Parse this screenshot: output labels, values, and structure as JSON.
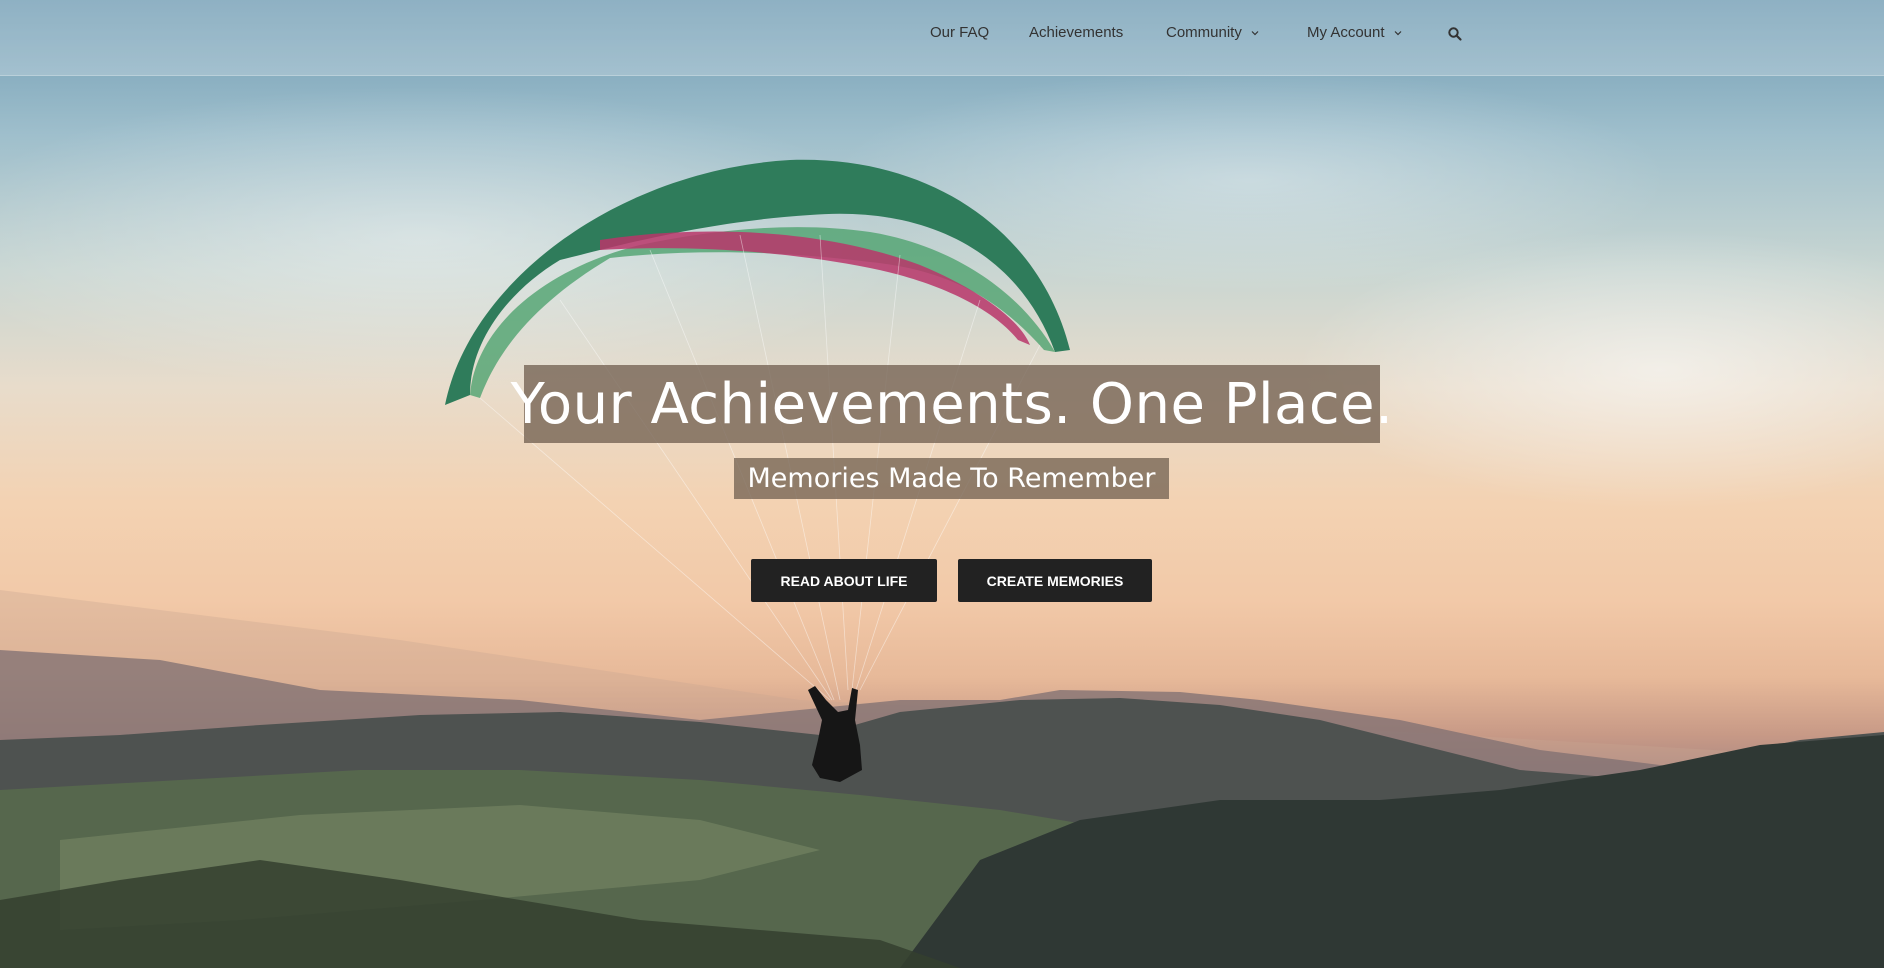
{
  "nav": {
    "items": [
      {
        "label": "Our FAQ"
      },
      {
        "label": "Achievements"
      },
      {
        "label": "Community"
      },
      {
        "label": "My Account"
      }
    ],
    "search_icon": "search-icon"
  },
  "hero": {
    "title": "Your Achievements. One Place.",
    "subtitle": "Memories Made To Remember",
    "buttons": {
      "read_about_life": "READ ABOUT LIFE",
      "create_memories": "CREATE MEMORIES"
    }
  },
  "colors": {
    "button_bg": "#222222",
    "button_text": "#ffffff",
    "title_box_bg": "#736252",
    "nav_text": "#333333"
  }
}
